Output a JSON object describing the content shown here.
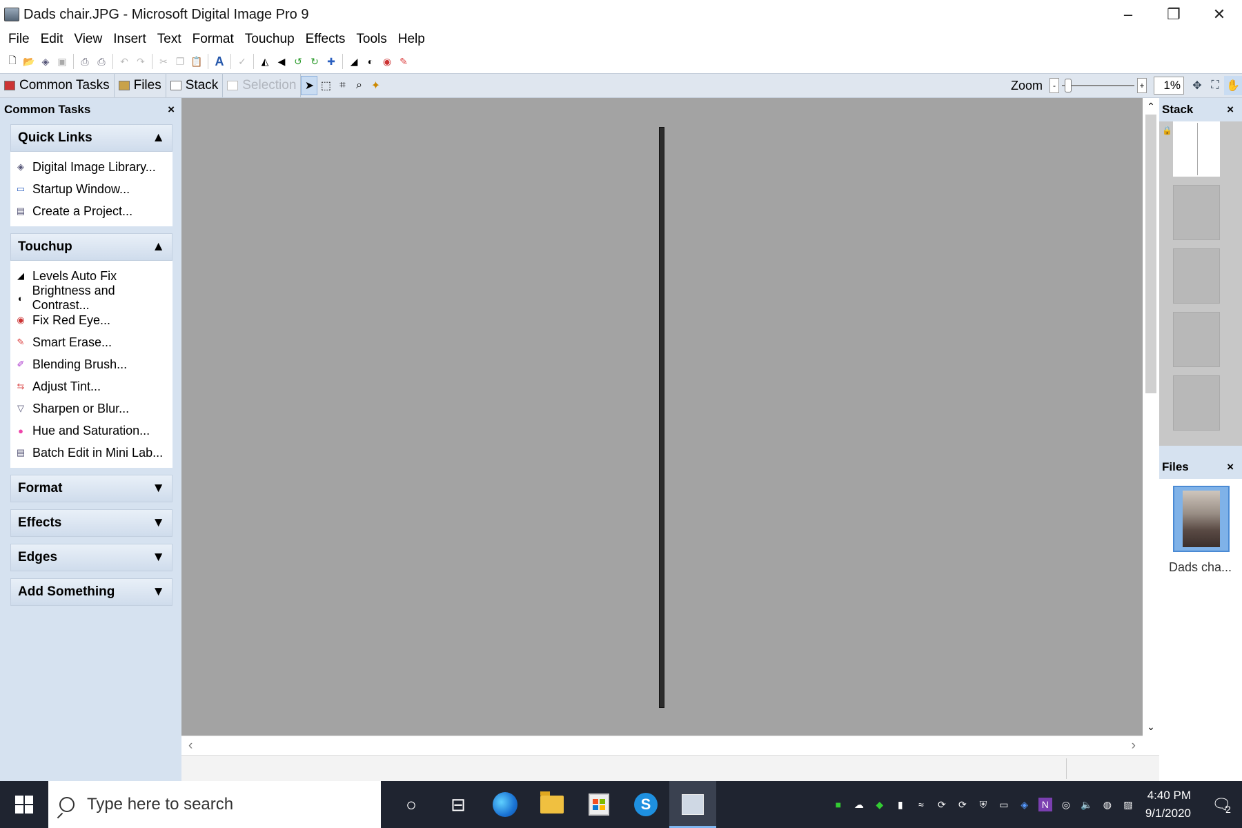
{
  "window": {
    "title": "Dads chair.JPG - Microsoft Digital Image Pro 9",
    "minimize_glyph": "–",
    "restore_glyph": "❐",
    "close_glyph": "✕"
  },
  "menu": [
    "File",
    "Edit",
    "View",
    "Insert",
    "Text",
    "Format",
    "Touchup",
    "Effects",
    "Tools",
    "Help"
  ],
  "tabbar": {
    "tabs": [
      {
        "label": "Common Tasks",
        "disabled": false
      },
      {
        "label": "Files",
        "disabled": false
      },
      {
        "label": "Stack",
        "disabled": false
      },
      {
        "label": "Selection",
        "disabled": true
      }
    ],
    "zoom_label": "Zoom",
    "zoom_value": "1%",
    "zoom_minus": "-",
    "zoom_plus": "+"
  },
  "left_panel": {
    "title": "Common Tasks",
    "close_glyph": "×",
    "groups": [
      {
        "title": "Quick Links",
        "expanded": true,
        "items": [
          "Digital Image Library...",
          "Startup Window...",
          "Create a Project..."
        ]
      },
      {
        "title": "Touchup",
        "expanded": true,
        "items": [
          "Levels Auto Fix",
          "Brightness and Contrast...",
          "Fix Red Eye...",
          "Smart Erase...",
          "Blending Brush...",
          "Adjust Tint...",
          "Sharpen or Blur...",
          "Hue and Saturation...",
          "Batch Edit in Mini Lab..."
        ]
      },
      {
        "title": "Format",
        "expanded": false
      },
      {
        "title": "Effects",
        "expanded": false
      },
      {
        "title": "Edges",
        "expanded": false
      },
      {
        "title": "Add Something",
        "expanded": false
      }
    ]
  },
  "right_panel": {
    "stack_title": "Stack",
    "files_title": "Files",
    "close_glyph": "×",
    "file_name": "Dads cha..."
  },
  "taskbar": {
    "search_placeholder": "Type here to search",
    "time": "4:40 PM",
    "date": "9/1/2020",
    "notification_count": "2"
  },
  "colors": {
    "canvas": "#a3a3a3",
    "panel": "#d6e2f0",
    "taskbar": "#1f2430"
  }
}
